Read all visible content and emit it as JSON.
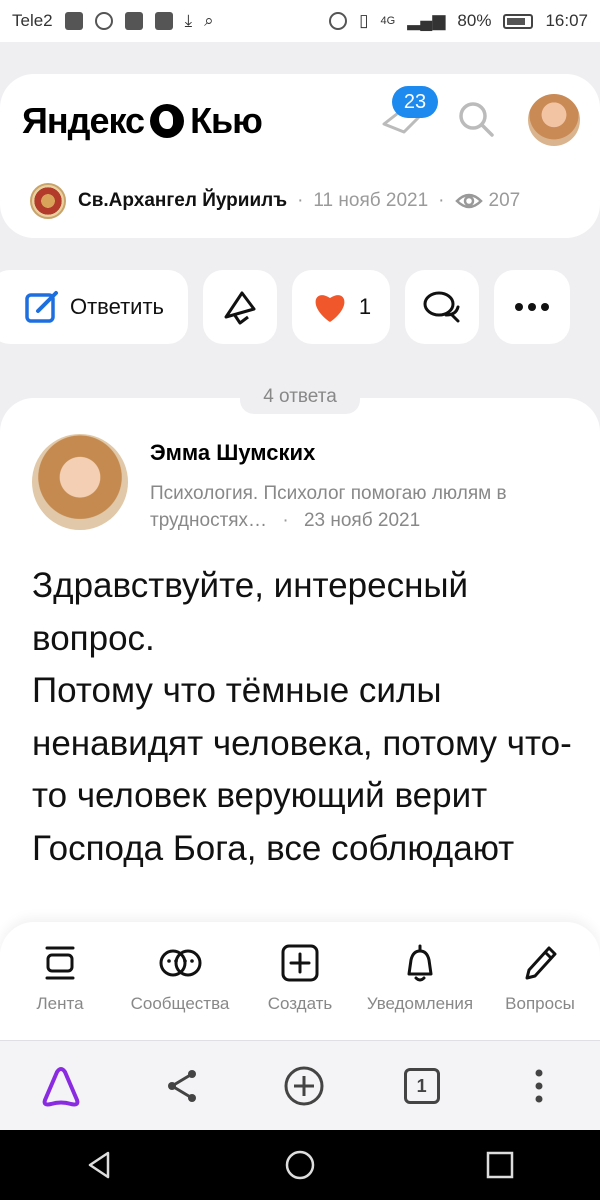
{
  "status_bar": {
    "carrier": "Tele2",
    "network": "4G",
    "battery": "80%",
    "time": "16:07"
  },
  "header": {
    "logo_text_left": "Яндекс",
    "logo_text_right": "Кью",
    "notifications_count": "23"
  },
  "question": {
    "author": "Св.Архангел Йуриилъ",
    "date": "11 нояб 2021",
    "views": "207"
  },
  "actions": {
    "answer_label": "Ответить",
    "likes": "1"
  },
  "answers": {
    "count_label": "4 ответа",
    "items": [
      {
        "author": "Эмма Шумских",
        "description": "Психология. Психолог помогаю люлям в трудностях…",
        "date": "23 нояб 2021",
        "text": "Здравствуйте, интересный вопрос.\nПотому что тёмные силы ненавидят человека, потому что-то человек верующий верит Господа Бога, все соблюдают"
      }
    ]
  },
  "bottom_nav": [
    {
      "label": "Лента",
      "icon": "feed-icon"
    },
    {
      "label": "Сообщества",
      "icon": "communities-icon"
    },
    {
      "label": "Создать",
      "icon": "create-icon"
    },
    {
      "label": "Уведомления",
      "icon": "bell-icon"
    },
    {
      "label": "Вопросы",
      "icon": "pencil-icon"
    }
  ],
  "browser_bar": {
    "tabs_count": "1"
  },
  "colors": {
    "accent": "#1d8af0",
    "alice": "#8a2be2",
    "like": "#f0582b",
    "answer_button": "#1d6fe0"
  }
}
